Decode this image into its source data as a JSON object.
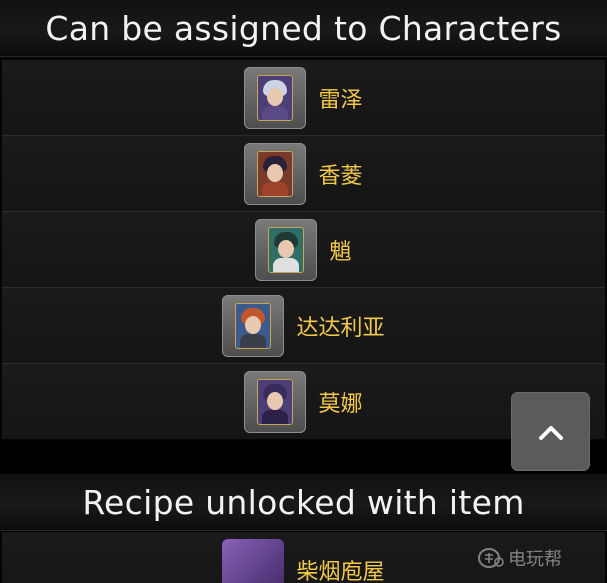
{
  "characters_section": {
    "title": "Can be assigned to Characters",
    "items": [
      {
        "name": "雷泽",
        "avatar_icon": "character-avatar-razor",
        "hair": "#cfd3e6",
        "body": "#5a4a86",
        "bg": "#4b3f75"
      },
      {
        "name": "香菱",
        "avatar_icon": "character-avatar-xiangling",
        "hair": "#2a2037",
        "body": "#a0432c",
        "bg": "#7a3a2a"
      },
      {
        "name": "魈",
        "avatar_icon": "character-avatar-xiao",
        "hair": "#1f3a33",
        "body": "#e0e0e0",
        "bg": "#2f6e67"
      },
      {
        "name": "达达利亚",
        "avatar_icon": "character-avatar-tartaglia",
        "hair": "#c0562b",
        "body": "#3a3f4a",
        "bg": "#3c5a8a"
      },
      {
        "name": "莫娜",
        "avatar_icon": "character-avatar-mona",
        "hair": "#3a2a5c",
        "body": "#2a2048",
        "bg": "#4b3f75"
      }
    ]
  },
  "recipe_section": {
    "title": "Recipe unlocked with item",
    "items": [
      {
        "name": "柴烟庖屋",
        "icon": "recipe-item-icon"
      }
    ]
  },
  "scroll_top_button": {
    "icon": "chevron-up-icon"
  },
  "watermark": {
    "text": "电玩帮",
    "icon": "watermark-logo-icon"
  },
  "colors": {
    "name_text": "#f2c94c",
    "header_text": "#f2f2f2"
  }
}
